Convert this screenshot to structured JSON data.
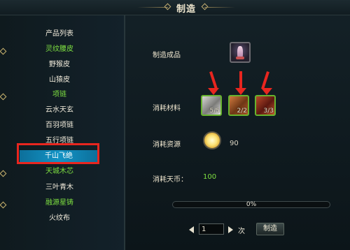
{
  "window": {
    "title": "制造"
  },
  "sidebar": {
    "items": [
      {
        "label": "产品列表",
        "color": "white"
      },
      {
        "label": "灵纹腰皮",
        "color": "green",
        "marker": true
      },
      {
        "label": "野猴皮",
        "color": "white"
      },
      {
        "label": "山猿皮",
        "color": "white"
      },
      {
        "label": "项链",
        "color": "green",
        "marker": true
      },
      {
        "label": "云水天玄",
        "color": "white"
      },
      {
        "label": "百羽项链",
        "color": "white"
      },
      {
        "label": "五行项链",
        "color": "white"
      },
      {
        "label": "千山飞绝",
        "color": "white",
        "selected": true
      },
      {
        "label": "天城木芯",
        "color": "green",
        "marker": true
      },
      {
        "label": "三叶青木",
        "color": "white"
      },
      {
        "label": "融源星铸",
        "color": "green",
        "marker": true
      },
      {
        "label": "火纹布",
        "color": "white"
      }
    ]
  },
  "main": {
    "product_label": "制造成品",
    "materials_label": "消耗材料",
    "materials": [
      {
        "icon": "silver-fabric-icon",
        "count": "5/5"
      },
      {
        "icon": "copper-bar-icon",
        "count": "2/2"
      },
      {
        "icon": "red-leather-icon",
        "count": "3/3"
      }
    ],
    "resource_label": "消耗资源",
    "resource_value": "90",
    "coins_label": "消耗天币：",
    "coins_value": "100",
    "progress": {
      "percent_text": "0%",
      "fraction": 0
    },
    "quantity": "1",
    "unit_label": "次",
    "craft_button": "制造"
  },
  "colors": {
    "accent_green": "#7ee041",
    "selected_blue": "#1293c5",
    "highlight_red": "#e8261f",
    "gold": "#c2ad72"
  }
}
